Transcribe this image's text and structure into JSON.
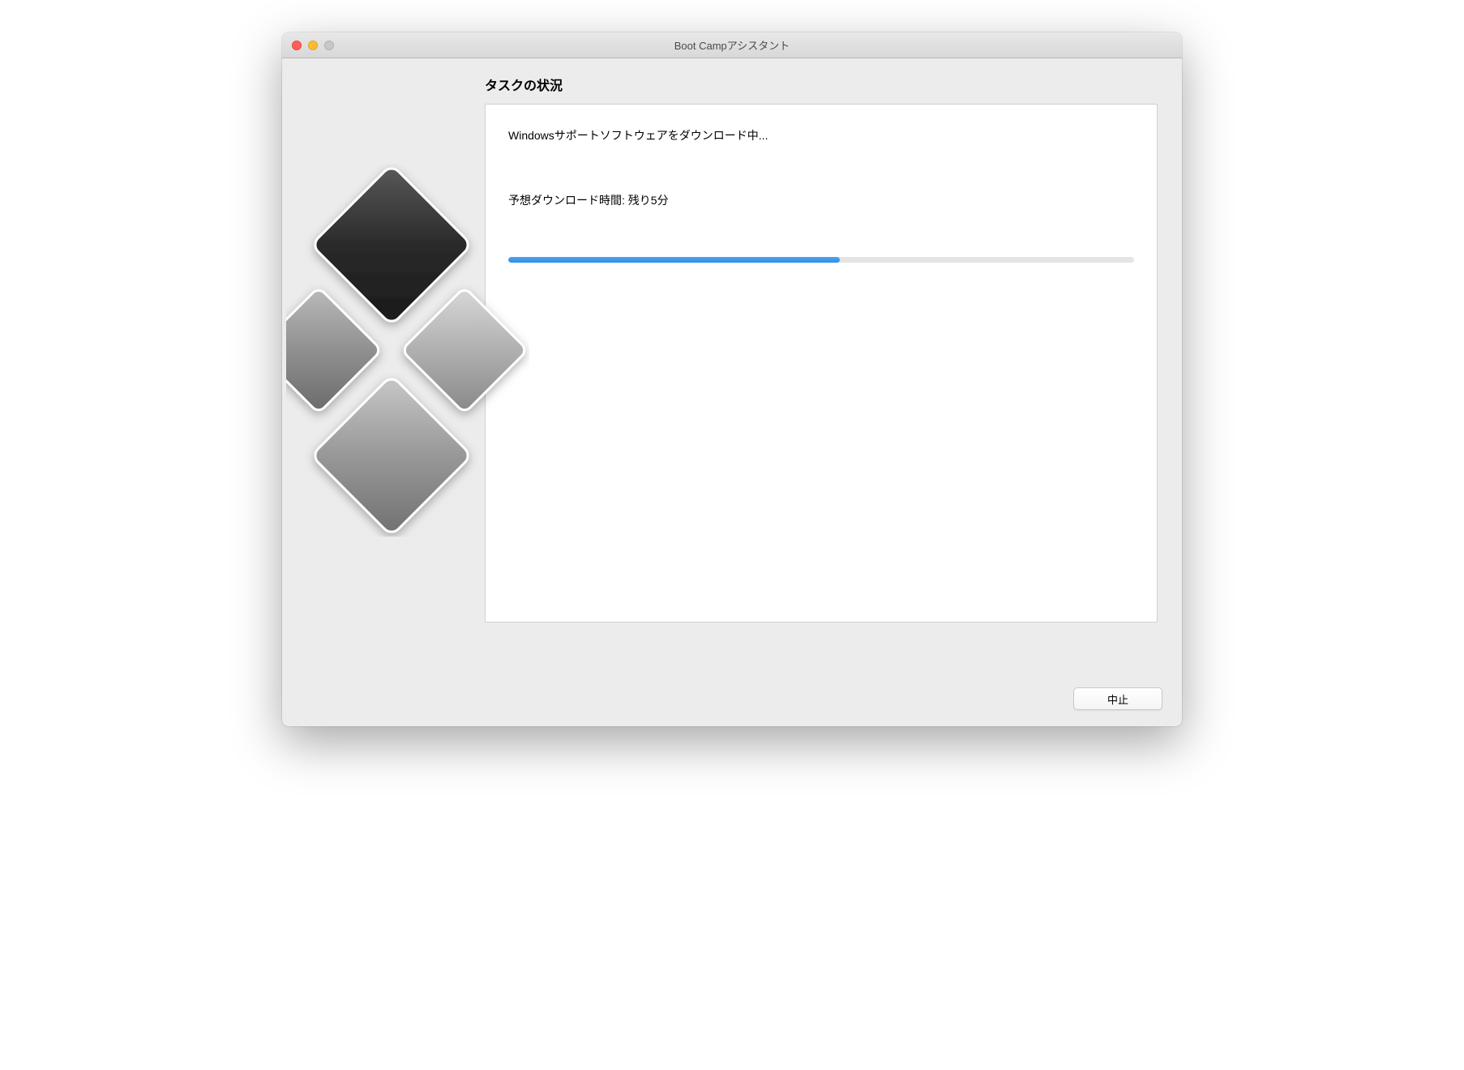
{
  "window": {
    "title": "Boot Campアシスタント"
  },
  "main": {
    "heading": "タスクの状況",
    "status": "Windowsサポートソフトウェアをダウンロード中...",
    "eta": "予想ダウンロード時間: 残り5分",
    "progress_percent": 53
  },
  "buttons": {
    "cancel": "中止"
  },
  "icons": {
    "close": "close-icon",
    "minimize": "minimize-icon",
    "maximize": "maximize-icon",
    "bootcamp": "bootcamp-logo-icon"
  }
}
